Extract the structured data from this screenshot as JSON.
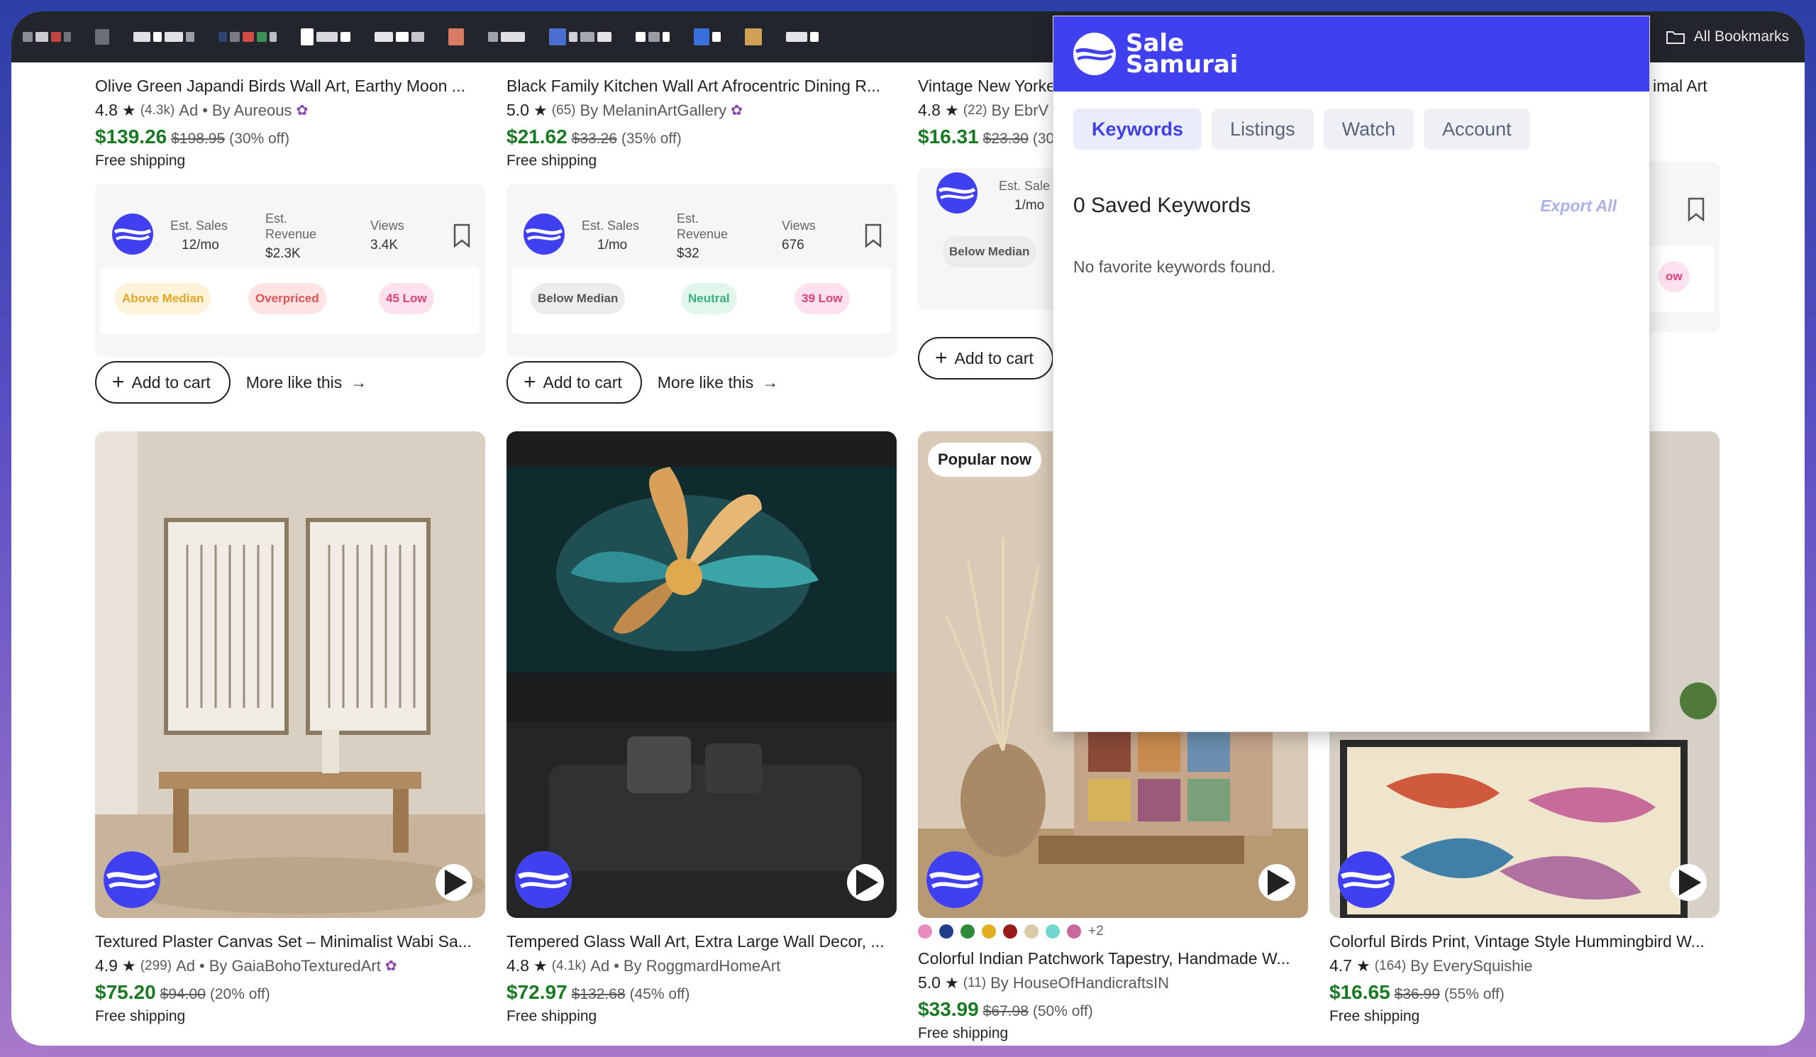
{
  "bookmarks_bar": {
    "all_bookmarks_label": "All Bookmarks"
  },
  "colors": {
    "brand": "#4040f0",
    "price_green": "#1a7a24"
  },
  "top_row": [
    {
      "title": "Olive Green Japandi Birds Wall Art, Earthy Moon ...",
      "rating": "4.8",
      "reviews": "(4.3k)",
      "ad": "Ad",
      "shop": "By Aureous",
      "price": "$139.26",
      "original_price": "$198.95",
      "discount": "(30% off)",
      "shipping": "Free shipping",
      "metrics": {
        "sales_label": "Est. Sales",
        "sales": "12/mo",
        "revenue_label_1": "Est.",
        "revenue_label_2": "Revenue",
        "revenue": "$2.3K",
        "views_label": "Views",
        "views": "3.4K",
        "badges": [
          "Above Median",
          "Overpriced",
          "45 Low"
        ]
      },
      "add_to_cart": "Add to cart",
      "more_like_this": "More like this"
    },
    {
      "title": "Black Family Kitchen Wall Art Afrocentric Dining R...",
      "rating": "5.0",
      "reviews": "(65)",
      "ad": "",
      "shop": "By MelaninArtGallery",
      "price": "$21.62",
      "original_price": "$33.26",
      "discount": "(35% off)",
      "shipping": "Free shipping",
      "metrics": {
        "sales_label": "Est. Sales",
        "sales": "1/mo",
        "revenue_label_1": "Est.",
        "revenue_label_2": "Revenue",
        "revenue": "$32",
        "views_label": "Views",
        "views": "676",
        "badges": [
          "Below Median",
          "Neutral",
          "39 Low"
        ]
      },
      "add_to_cart": "Add to cart",
      "more_like_this": "More like this"
    },
    {
      "title": "Vintage New Yorke",
      "rating": "4.8",
      "reviews": "(22)",
      "shop": "By EbrV",
      "price": "$16.31",
      "original_price": "$23.30",
      "discount": "(30",
      "metrics": {
        "sales_label": "Est. Sale",
        "sales": "1/mo",
        "badges": [
          "Below Median"
        ]
      },
      "add_to_cart": "Add to cart"
    },
    {
      "title_fragment": "imal Art",
      "badge_fragment": "ow"
    }
  ],
  "bottom_row": [
    {
      "title": "Textured Plaster Canvas Set – Minimalist Wabi Sa...",
      "rating": "4.9",
      "reviews": "(299)",
      "ad": "Ad",
      "shop": "By GaiaBohoTexturedArt",
      "price": "$75.20",
      "original_price": "$94.00",
      "discount": "(20% off)",
      "shipping": "Free shipping"
    },
    {
      "title": "Tempered Glass Wall Art, Extra Large Wall Decor, ...",
      "rating": "4.8",
      "reviews": "(4.1k)",
      "ad": "Ad",
      "shop": "By RoggmardHomeArt",
      "price": "$72.97",
      "original_price": "$132.68",
      "discount": "(45% off)",
      "shipping": "Free shipping"
    },
    {
      "popular_label": "Popular now",
      "swatch_more": "+2",
      "title": "Colorful Indian Patchwork Tapestry, Handmade W...",
      "rating": "5.0",
      "reviews": "(11)",
      "shop": "By HouseOfHandicraftsIN",
      "price": "$33.99",
      "original_price": "$67.98",
      "discount": "(50% off)",
      "shipping": "Free shipping"
    },
    {
      "title": "Colorful Birds Print, Vintage Style Hummingbird W...",
      "rating": "4.7",
      "reviews": "(164)",
      "shop": "By EverySquishie",
      "price": "$16.65",
      "original_price": "$36.99",
      "discount": "(55% off)",
      "shipping": "Free shipping"
    }
  ],
  "popup": {
    "brand_line1": "Sale",
    "brand_line2": "Samurai",
    "tabs": [
      "Keywords",
      "Listings",
      "Watch",
      "Account"
    ],
    "active_tab": "Keywords",
    "saved_title": "0 Saved Keywords",
    "export_label": "Export All",
    "empty_message": "No favorite keywords found."
  }
}
